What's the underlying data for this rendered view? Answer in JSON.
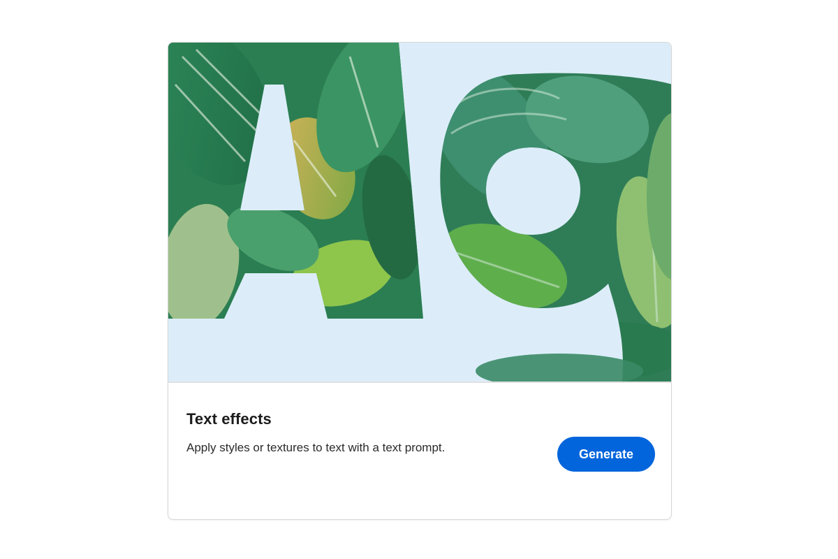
{
  "card": {
    "title": "Text effects",
    "description": "Apply styles or textures to text with a text prompt.",
    "button_label": "Generate",
    "accent_color": "#0265dc",
    "image": {
      "letters": [
        "A",
        "9"
      ],
      "style": "tropical leaves",
      "background_color": "#dcedf9"
    }
  }
}
